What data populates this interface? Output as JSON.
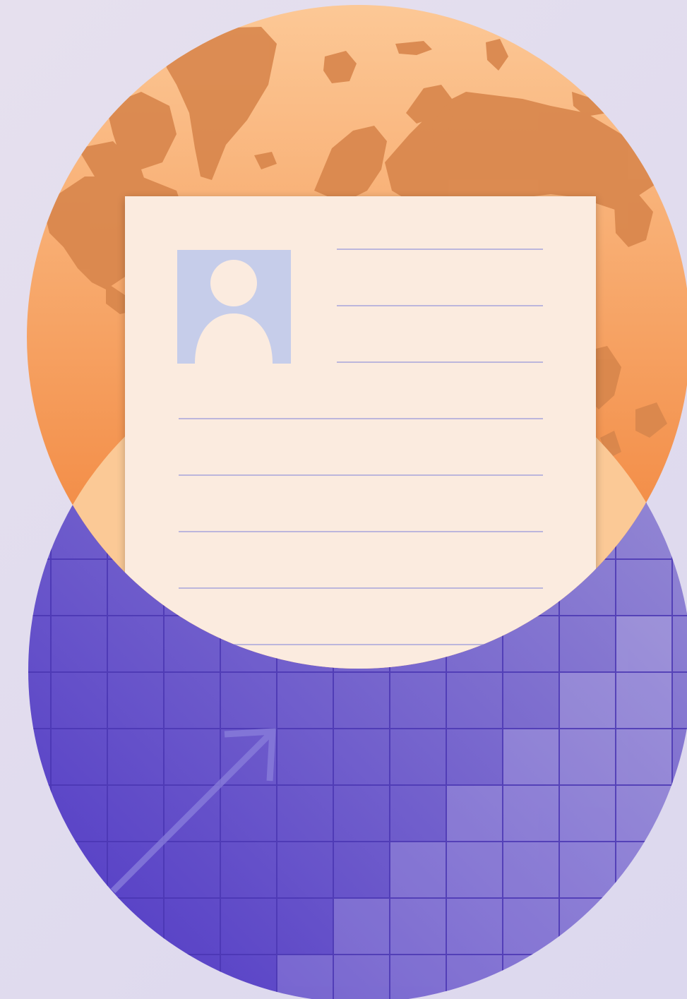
{
  "colors": {
    "background_start": "#e6e0ee",
    "background_end": "#dcd8ee",
    "globe_top": "#fcc896",
    "globe_bottom": "#f07c30",
    "continent": "#d9864a",
    "grid_base": "#5a44c8",
    "grid_line": "#4a36b0",
    "grid_highlight": "#8c80d6",
    "arrow": "#7e70d4",
    "document_paper": "#fbebdf",
    "document_rule": "#a8a4dc",
    "avatar_background": "#c6cdea",
    "avatar_silhouette": "#fbebdf",
    "overlap_band": "#fbc996"
  },
  "icons": {
    "globe": "globe-icon",
    "growth_chart": "growth-chart-icon",
    "arrow": "trend-arrow-icon",
    "resume": "resume-document-icon",
    "avatar": "person-avatar-icon"
  }
}
